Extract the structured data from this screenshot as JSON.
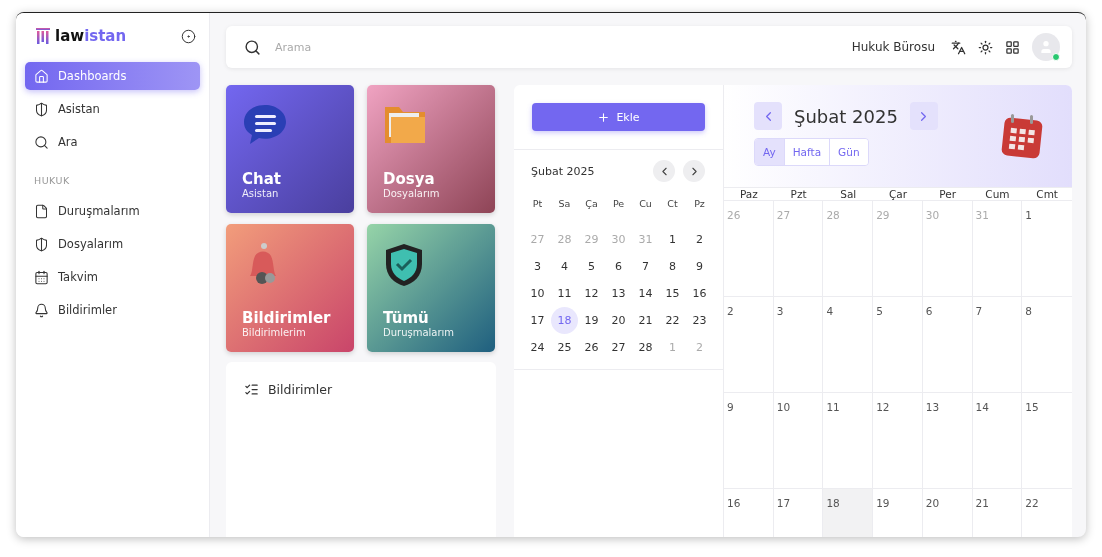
{
  "sidebar": {
    "logo": {
      "part1": "law",
      "part2": "istan"
    },
    "items": [
      {
        "label": "Dashboards",
        "selected": true
      },
      {
        "label": "Asistan",
        "selected": false
      },
      {
        "label": "Ara",
        "selected": false
      }
    ],
    "section": "HUKUK",
    "section_items": [
      {
        "label": "Duruşmalarım",
        "selected": false
      },
      {
        "label": "Dosyalarım",
        "selected": false
      },
      {
        "label": "Takvim",
        "selected": false
      },
      {
        "label": "Bildirimler",
        "selected": false
      }
    ]
  },
  "topbar": {
    "search": {
      "placeholder": "Arama"
    },
    "org": "Hukuk Bürosu",
    "user_online": true
  },
  "cards": [
    {
      "title": "Chat",
      "subtitle": "Asistan",
      "kind": "chat"
    },
    {
      "title": "Dosya",
      "subtitle": "Dosyalarım",
      "kind": "folder"
    },
    {
      "title": "Bildirimler",
      "subtitle": "Bildirimlerim",
      "kind": "bell"
    },
    {
      "title": "Tümü",
      "subtitle": "Duruşmalarım",
      "kind": "shield"
    }
  ],
  "notifications": {
    "title": "Bildirimler"
  },
  "mini_calendar": {
    "add_button": "Ekle",
    "title": "Şubat 2025",
    "weekdays": [
      "Pt",
      "Sa",
      "Ça",
      "Pe",
      "Cu",
      "Ct",
      "Pz"
    ],
    "weeks": [
      [
        {
          "d": "27",
          "muted": true,
          "selected": false
        },
        {
          "d": "28",
          "muted": true,
          "selected": false
        },
        {
          "d": "29",
          "muted": true,
          "selected": false
        },
        {
          "d": "30",
          "muted": true,
          "selected": false
        },
        {
          "d": "31",
          "muted": true,
          "selected": false
        },
        {
          "d": "1",
          "muted": false,
          "selected": false
        },
        {
          "d": "2",
          "muted": false,
          "selected": false
        }
      ],
      [
        {
          "d": "3",
          "muted": false,
          "selected": false
        },
        {
          "d": "4",
          "muted": false,
          "selected": false
        },
        {
          "d": "5",
          "muted": false,
          "selected": false
        },
        {
          "d": "6",
          "muted": false,
          "selected": false
        },
        {
          "d": "7",
          "muted": false,
          "selected": false
        },
        {
          "d": "8",
          "muted": false,
          "selected": false
        },
        {
          "d": "9",
          "muted": false,
          "selected": false
        }
      ],
      [
        {
          "d": "10",
          "muted": false,
          "selected": false
        },
        {
          "d": "11",
          "muted": false,
          "selected": false
        },
        {
          "d": "12",
          "muted": false,
          "selected": false
        },
        {
          "d": "13",
          "muted": false,
          "selected": false
        },
        {
          "d": "14",
          "muted": false,
          "selected": false
        },
        {
          "d": "15",
          "muted": false,
          "selected": false
        },
        {
          "d": "16",
          "muted": false,
          "selected": false
        }
      ],
      [
        {
          "d": "17",
          "muted": false,
          "selected": false
        },
        {
          "d": "18",
          "muted": false,
          "selected": true
        },
        {
          "d": "19",
          "muted": false,
          "selected": false
        },
        {
          "d": "20",
          "muted": false,
          "selected": false
        },
        {
          "d": "21",
          "muted": false,
          "selected": false
        },
        {
          "d": "22",
          "muted": false,
          "selected": false
        },
        {
          "d": "23",
          "muted": false,
          "selected": false
        }
      ],
      [
        {
          "d": "24",
          "muted": false,
          "selected": false
        },
        {
          "d": "25",
          "muted": false,
          "selected": false
        },
        {
          "d": "26",
          "muted": false,
          "selected": false
        },
        {
          "d": "27",
          "muted": false,
          "selected": false
        },
        {
          "d": "28",
          "muted": false,
          "selected": false
        },
        {
          "d": "1",
          "muted": true,
          "selected": false
        },
        {
          "d": "2",
          "muted": true,
          "selected": false
        }
      ]
    ]
  },
  "month_calendar": {
    "title": "Şubat 2025",
    "views": [
      {
        "label": "Ay",
        "selected": true
      },
      {
        "label": "Hafta",
        "selected": false
      },
      {
        "label": "Gün",
        "selected": false
      }
    ],
    "weekdays": [
      "Paz",
      "Pzt",
      "Sal",
      "Çar",
      "Per",
      "Cum",
      "Cmt"
    ],
    "weeks": [
      [
        {
          "d": "26",
          "muted": true,
          "today": false
        },
        {
          "d": "27",
          "muted": true,
          "today": false
        },
        {
          "d": "28",
          "muted": true,
          "today": false
        },
        {
          "d": "29",
          "muted": true,
          "today": false
        },
        {
          "d": "30",
          "muted": true,
          "today": false
        },
        {
          "d": "31",
          "muted": true,
          "today": false
        },
        {
          "d": "1",
          "muted": false,
          "today": false
        }
      ],
      [
        {
          "d": "2",
          "muted": false,
          "today": false
        },
        {
          "d": "3",
          "muted": false,
          "today": false
        },
        {
          "d": "4",
          "muted": false,
          "today": false
        },
        {
          "d": "5",
          "muted": false,
          "today": false
        },
        {
          "d": "6",
          "muted": false,
          "today": false
        },
        {
          "d": "7",
          "muted": false,
          "today": false
        },
        {
          "d": "8",
          "muted": false,
          "today": false
        }
      ],
      [
        {
          "d": "9",
          "muted": false,
          "today": false
        },
        {
          "d": "10",
          "muted": false,
          "today": false
        },
        {
          "d": "11",
          "muted": false,
          "today": false
        },
        {
          "d": "12",
          "muted": false,
          "today": false
        },
        {
          "d": "13",
          "muted": false,
          "today": false
        },
        {
          "d": "14",
          "muted": false,
          "today": false
        },
        {
          "d": "15",
          "muted": false,
          "today": false
        }
      ],
      [
        {
          "d": "16",
          "muted": false,
          "today": false
        },
        {
          "d": "17",
          "muted": false,
          "today": false
        },
        {
          "d": "18",
          "muted": false,
          "today": true
        },
        {
          "d": "19",
          "muted": false,
          "today": false
        },
        {
          "d": "20",
          "muted": false,
          "today": false
        },
        {
          "d": "21",
          "muted": false,
          "today": false
        },
        {
          "d": "22",
          "muted": false,
          "today": false
        }
      ]
    ]
  }
}
